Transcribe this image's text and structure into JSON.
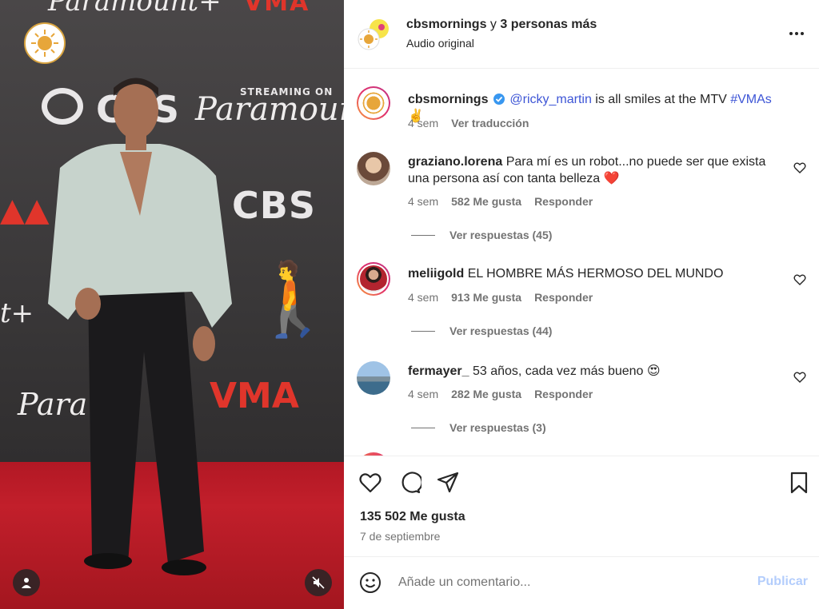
{
  "header": {
    "author": "cbsmornings",
    "connector": "y",
    "others": "3 personas más",
    "audio": "Audio original"
  },
  "caption": {
    "username": "cbsmornings",
    "mention": "@ricky_martin",
    "text": " is all smiles at the MTV ",
    "hashtag": "#VMAs",
    "emoji": "✌️",
    "age": "4 sem",
    "translate": "Ver traducción"
  },
  "comments": [
    {
      "username": "graziano.lorena",
      "text": "Para mí es un robot...no puede ser que exista una persona así con tanta belleza ❤️",
      "age": "4 sem",
      "likes": "582 Me gusta",
      "reply": "Responder",
      "view_replies": "Ver respuestas (45)"
    },
    {
      "username": "meliigold",
      "text": "EL HOMBRE MÁS HERMOSO DEL MUNDO",
      "age": "4 sem",
      "likes": "913 Me gusta",
      "reply": "Responder",
      "view_replies": "Ver respuestas (44)"
    },
    {
      "username": "fermayer_",
      "text": "53 años, cada vez más bueno 😍",
      "age": "4 sem",
      "likes": "282 Me gusta",
      "reply": "Responder",
      "view_replies": "Ver respuestas (3)"
    }
  ],
  "stats": {
    "likes": "135 502 Me gusta",
    "date": "7 de septiembre"
  },
  "composer": {
    "placeholder": "Añade un comentario...",
    "publish": "Publicar"
  },
  "media": {
    "backdrop_logos": [
      "Paramount+",
      "STREAMING ON",
      "CBS",
      "VMA"
    ]
  },
  "colors": {
    "link_blue": "#3d55d6",
    "mention_blue": "#00376b",
    "publish_disabled": "#b3cdfc",
    "carpet_red": "#c21f2b",
    "verified": "#3897f0"
  }
}
